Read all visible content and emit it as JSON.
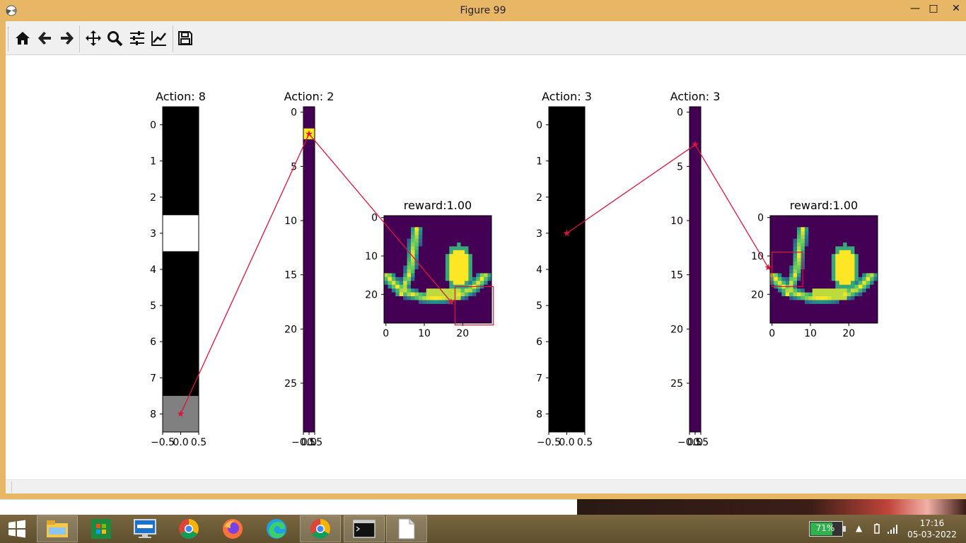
{
  "window": {
    "title": "Figure 99",
    "buttons": {
      "minimize": "—",
      "maximize": "□",
      "close": "✕"
    }
  },
  "toolbar": {
    "tools": [
      "home-icon",
      "back-arrow-icon",
      "forward-arrow-icon",
      "pan-move-icon",
      "zoom-magnifier-icon",
      "configure-subplots-icon",
      "edit-axis-icon",
      "save-floppy-icon"
    ]
  },
  "figure": {
    "titles": [
      "Action: 8",
      "Action: 2",
      "reward:1.00",
      "Action: 3",
      "Action: 3",
      "reward:1.00"
    ],
    "colors": {
      "line": "#dc143c",
      "viridis_dark": "#440154",
      "viridis_yellow": "#fde725",
      "white": "#ffffff",
      "black": "#000000",
      "gray": "#808080"
    }
  },
  "chart_data": [
    {
      "type": "heatmap",
      "title": "Action: 8",
      "columns": 1,
      "rows": [
        0,
        1,
        2,
        3,
        4,
        5,
        6,
        7,
        8
      ],
      "values": [
        0,
        0,
        0,
        1,
        0,
        0,
        0,
        0,
        0.5
      ],
      "yticks": [
        "0",
        "1",
        "2",
        "3",
        "4",
        "5",
        "6",
        "7",
        "8"
      ],
      "xticks": [
        "−0.5",
        "0.0",
        "0.5"
      ],
      "colormap": "gray",
      "marker": {
        "x": 0,
        "y": 8
      }
    },
    {
      "type": "heatmap",
      "title": "Action: 2",
      "columns": 1,
      "row_count": 30,
      "highlight_row": 2,
      "yticks": [
        "0",
        "5",
        "10",
        "15",
        "20",
        "25"
      ],
      "xticks": [
        "−0.5",
        "0.0",
        "0.5"
      ],
      "colormap": "viridis",
      "marker": {
        "x": 0,
        "y": 2
      }
    },
    {
      "type": "heatmap",
      "title": "reward:1.00",
      "size": 28,
      "yticks": [
        "0",
        "10",
        "20"
      ],
      "xticks": [
        "0",
        "10",
        "20"
      ],
      "colormap": "viridis",
      "glimpse_box": {
        "x0": 18,
        "x1": 28,
        "y0": 18,
        "y1": 28
      },
      "marker": {
        "x": 17,
        "y": 22
      }
    },
    {
      "type": "heatmap",
      "title": "Action: 3",
      "columns": 1,
      "rows": [
        0,
        1,
        2,
        3,
        4,
        5,
        6,
        7,
        8
      ],
      "values": [
        0,
        0,
        0,
        0,
        0,
        0,
        0,
        0,
        0
      ],
      "yticks": [
        "0",
        "1",
        "2",
        "3",
        "4",
        "5",
        "6",
        "7",
        "8"
      ],
      "xticks": [
        "−0.5",
        "0.0",
        "0.5"
      ],
      "colormap": "gray",
      "marker": {
        "x": 0,
        "y": 3
      }
    },
    {
      "type": "heatmap",
      "title": "Action: 3",
      "columns": 1,
      "row_count": 30,
      "highlight_row": -1,
      "yticks": [
        "0",
        "5",
        "10",
        "15",
        "20",
        "25"
      ],
      "xticks": [
        "−0.5",
        "0.0",
        "0.5"
      ],
      "colormap": "viridis",
      "marker": {
        "x": 0,
        "y": 3
      }
    },
    {
      "type": "heatmap",
      "title": "reward:1.00",
      "size": 28,
      "yticks": [
        "0",
        "10",
        "20"
      ],
      "xticks": [
        "0",
        "10",
        "20"
      ],
      "colormap": "viridis",
      "glimpse_box": {
        "x0": 0,
        "x1": 8,
        "y0": 9,
        "y1": 18
      },
      "marker": {
        "x": -1,
        "y": 13
      }
    }
  ],
  "taskbar": {
    "apps": [
      "start-windows-icon",
      "file-explorer-icon",
      "store-icon",
      "lenovo-icon",
      "chrome-icon",
      "firefox-icon",
      "edge-icon",
      "chrome-icon",
      "terminal-icon",
      "notepad-icon"
    ],
    "battery": "71%",
    "time": "17:16",
    "date": "05-03-2022"
  }
}
